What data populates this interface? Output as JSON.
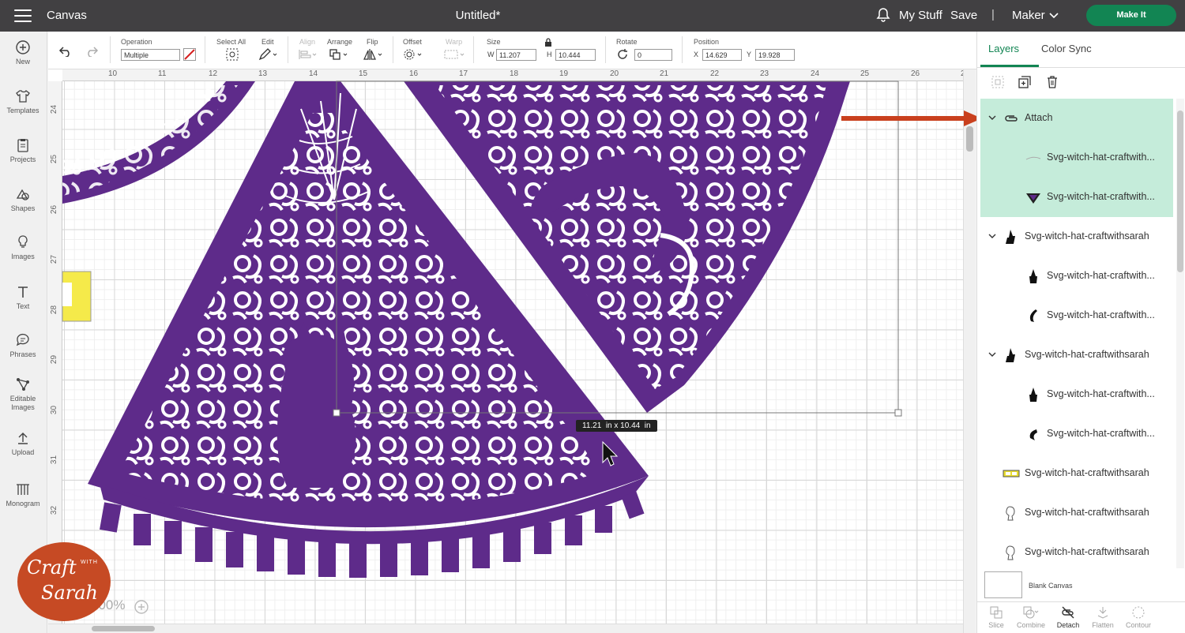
{
  "topbar": {
    "app_title": "Canvas",
    "doc_title": "Untitled*",
    "my_stuff": "My Stuff",
    "save": "Save",
    "separator": "|",
    "machine": "Maker",
    "make_it": "Make It"
  },
  "leftbar": {
    "items": [
      {
        "label": "New",
        "icon": "plus-icon"
      },
      {
        "label": "Templates",
        "icon": "shirt-icon"
      },
      {
        "label": "Projects",
        "icon": "clipboard-icon"
      },
      {
        "label": "Shapes",
        "icon": "shapes-icon"
      },
      {
        "label": "Images",
        "icon": "lightbulb-icon"
      },
      {
        "label": "Text",
        "icon": "text-icon"
      },
      {
        "label": "Phrases",
        "icon": "speech-bubble-icon"
      },
      {
        "label": "Editable Images",
        "icon": "editable-image-icon"
      },
      {
        "label": "Upload",
        "icon": "upload-icon"
      },
      {
        "label": "Monogram",
        "icon": "monogram-icon"
      }
    ]
  },
  "toolbar": {
    "operation_label": "Operation",
    "operation_value": "Multiple",
    "select_all": "Select All",
    "edit": "Edit",
    "align": "Align",
    "arrange": "Arrange",
    "flip": "Flip",
    "offset": "Offset",
    "warp": "Warp",
    "size_label": "Size",
    "w_label": "W",
    "w_value": "11.207",
    "h_label": "H",
    "h_value": "10.444",
    "rotate_label": "Rotate",
    "rotate_value": "0",
    "position_label": "Position",
    "x_label": "X",
    "x_value": "14.629",
    "y_label": "Y",
    "y_value": "19.928"
  },
  "canvas": {
    "ruler_top": [
      "10",
      "11",
      "12",
      "13",
      "14",
      "15",
      "16",
      "17",
      "18",
      "19",
      "20",
      "21",
      "22",
      "23",
      "24",
      "25",
      "26",
      "2"
    ],
    "ruler_left": [
      "24",
      "25",
      "26",
      "27",
      "28",
      "29",
      "30",
      "31",
      "32"
    ],
    "size_tooltip": "11.21  in x 10.44  in",
    "zoom": "100%",
    "design_color": "#5e2b8a"
  },
  "panel": {
    "tab_layers": "Layers",
    "tab_color_sync": "Color Sync",
    "layers": [
      {
        "label": "Attach",
        "level": 0,
        "expanded": true,
        "selected": true,
        "icon": "attach-icon"
      },
      {
        "label": "Svg-witch-hat-craftwith...",
        "level": 1,
        "selected": true,
        "icon": "line-thumb-icon"
      },
      {
        "label": "Svg-witch-hat-craftwith...",
        "level": 1,
        "selected": true,
        "icon": "hat-slice-thumb-icon"
      },
      {
        "label": "Svg-witch-hat-craftwithsarah",
        "level": 0,
        "expanded": true,
        "selected": false,
        "icon": "witch-group-icon"
      },
      {
        "label": "Svg-witch-hat-craftwith...",
        "level": 1,
        "selected": false,
        "icon": "witch-thumb-icon"
      },
      {
        "label": "Svg-witch-hat-craftwith...",
        "level": 1,
        "selected": false,
        "icon": "curve-thumb-icon"
      },
      {
        "label": "Svg-witch-hat-craftwithsarah",
        "level": 0,
        "expanded": true,
        "selected": false,
        "icon": "witch-group-icon"
      },
      {
        "label": "Svg-witch-hat-craftwith...",
        "level": 1,
        "selected": false,
        "icon": "witch-thumb-icon"
      },
      {
        "label": "Svg-witch-hat-craftwith...",
        "level": 1,
        "selected": false,
        "icon": "curve-thumb-icon"
      },
      {
        "label": "Svg-witch-hat-craftwithsarah",
        "level": 0,
        "selected": false,
        "icon": "band-thumb-icon"
      },
      {
        "label": "Svg-witch-hat-craftwithsarah",
        "level": 0,
        "selected": false,
        "icon": "outline-thumb-icon"
      },
      {
        "label": "Svg-witch-hat-craftwithsarah",
        "level": 0,
        "selected": false,
        "icon": "outline-thumb-icon"
      }
    ],
    "blank_canvas": "Blank Canvas",
    "bottom_tools": [
      {
        "label": "Slice",
        "enabled": false
      },
      {
        "label": "Combine",
        "enabled": false
      },
      {
        "label": "Detach",
        "enabled": true
      },
      {
        "label": "Flatten",
        "enabled": false
      },
      {
        "label": "Contour",
        "enabled": false
      }
    ]
  },
  "logo": {
    "line1": "Craft",
    "line2": "WITH",
    "line3": "Sarah"
  },
  "colors": {
    "accent": "#128553",
    "topbar": "#414042",
    "selected_layer": "#c5ecda",
    "arrow": "#c9401e"
  }
}
